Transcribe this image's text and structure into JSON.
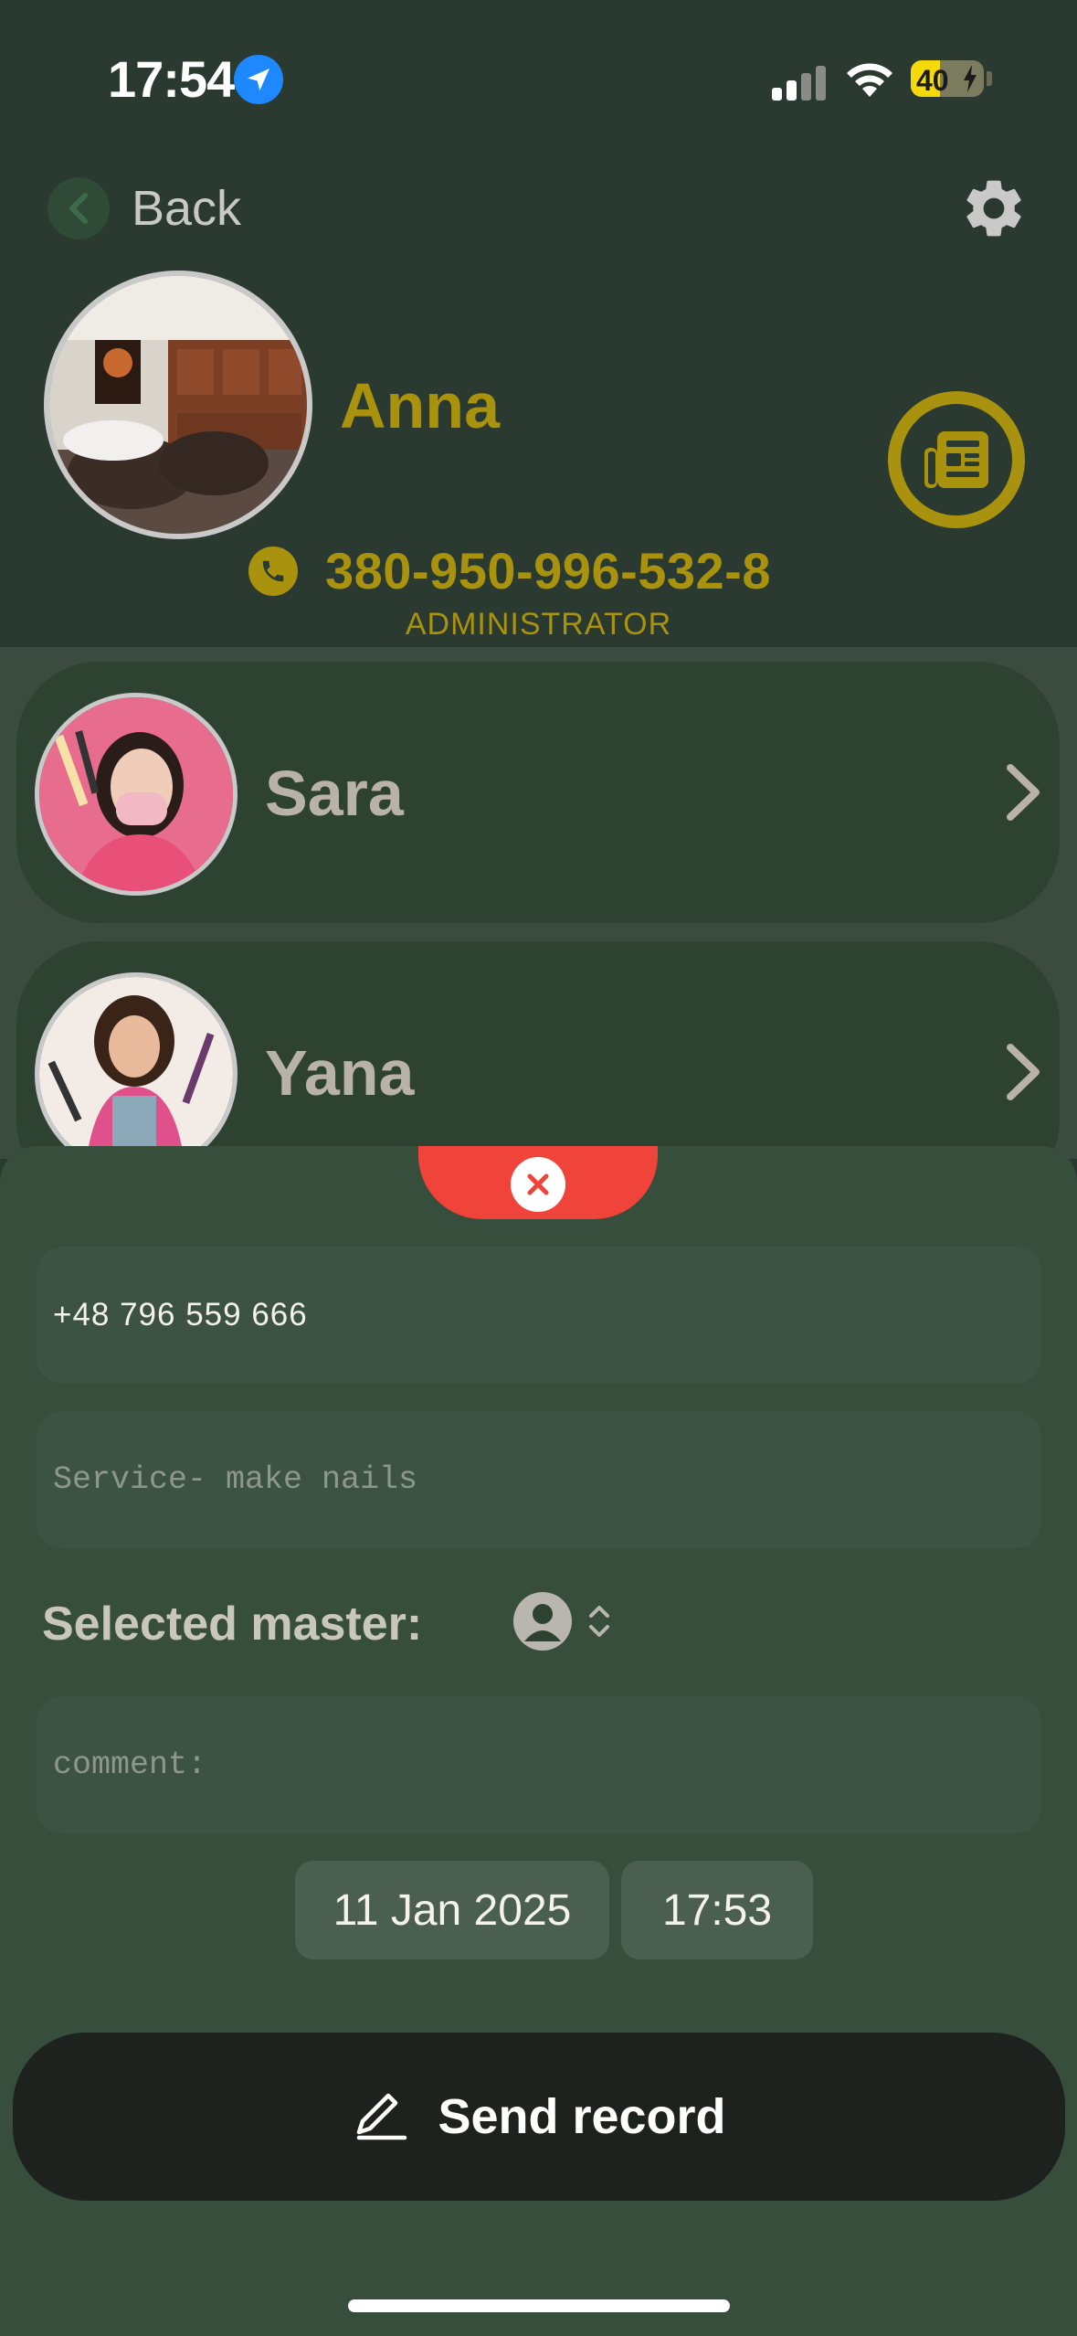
{
  "status_bar": {
    "time": "17:54",
    "battery": "40",
    "battery_level": 0.4
  },
  "header": {
    "back_label": "Back"
  },
  "profile": {
    "name": "Anna",
    "phone": "380-950-996-532-8",
    "role": "ADMINISTRATOR"
  },
  "masters": [
    {
      "name": "Sara"
    },
    {
      "name": "Yana"
    }
  ],
  "form": {
    "phone_value": "+48 796 559 666",
    "service_placeholder": "Service- make nails",
    "selected_master_label": "Selected master:",
    "comment_placeholder": "comment:",
    "date": "11 Jan 2025",
    "time": "17:53",
    "send_label": "Send record"
  },
  "colors": {
    "accent": "#a8920e",
    "close": "#f0433a",
    "sheet": "#374e3d"
  }
}
